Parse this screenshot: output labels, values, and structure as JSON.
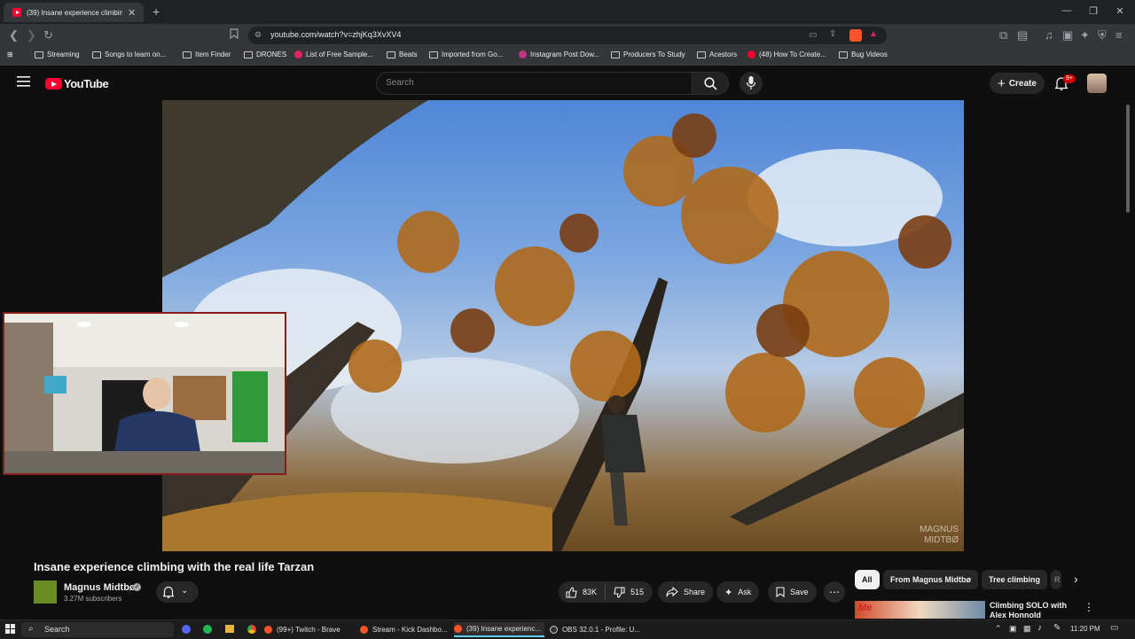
{
  "browser": {
    "active_tab_title": "(39) Insane experience climbin",
    "url": "youtube.com/watch?v=zhjKq3XvXV4",
    "bookmarks": [
      {
        "label": "Streaming",
        "icon": "folder-icon"
      },
      {
        "label": "Songs to learn on...",
        "icon": "folder-icon"
      },
      {
        "label": "Item Finder",
        "icon": "folder-icon"
      },
      {
        "label": "DRONES",
        "icon": "folder-icon"
      },
      {
        "label": "List of Free Sample...",
        "icon": "site-icon"
      },
      {
        "label": "Beats",
        "icon": "folder-icon"
      },
      {
        "label": "Imported from Go...",
        "icon": "folder-icon"
      },
      {
        "label": "Instagram Post Dow...",
        "icon": "site-icon"
      },
      {
        "label": "Producers To Study",
        "icon": "folder-icon"
      },
      {
        "label": "Acestors",
        "icon": "folder-icon"
      },
      {
        "label": "(48) How To Create...",
        "icon": "youtube-icon"
      },
      {
        "label": "Bug Videos",
        "icon": "folder-icon"
      }
    ]
  },
  "youtube": {
    "logo_text": "YouTube",
    "search_placeholder": "Search",
    "create_label": "Create",
    "notification_count": "9+",
    "video": {
      "title": "Insane experience climbing with the real life Tarzan",
      "watermark": "MAGNUS\nMIDTBØ",
      "channel_name": "Magnus Midtbø",
      "subscribers": "3.27M subscribers",
      "likes": "83K",
      "dislikes": "515",
      "share_label": "Share",
      "ask_label": "Ask",
      "save_label": "Save"
    },
    "chips": [
      "All",
      "From Magnus Midtbø",
      "Tree climbing",
      "R"
    ],
    "recommendation": {
      "title": "Climbing SOLO with Alex Honnold",
      "thumb_text": "Me"
    }
  },
  "taskbar": {
    "search_label": "Search",
    "apps": [
      {
        "label": "(99+) Twitch - Brave",
        "active": false
      },
      {
        "label": "Stream - Kick Dashbo...",
        "active": false
      },
      {
        "label": "(39) Insane experienc...",
        "active": true
      },
      {
        "label": "OBS 32.0.1 - Profile: U...",
        "active": false
      }
    ],
    "time": "11:20 PM"
  },
  "colors": {
    "accent": "#ff0033",
    "background": "#0f0f0f",
    "webcam_border": "#8b1a1a"
  }
}
